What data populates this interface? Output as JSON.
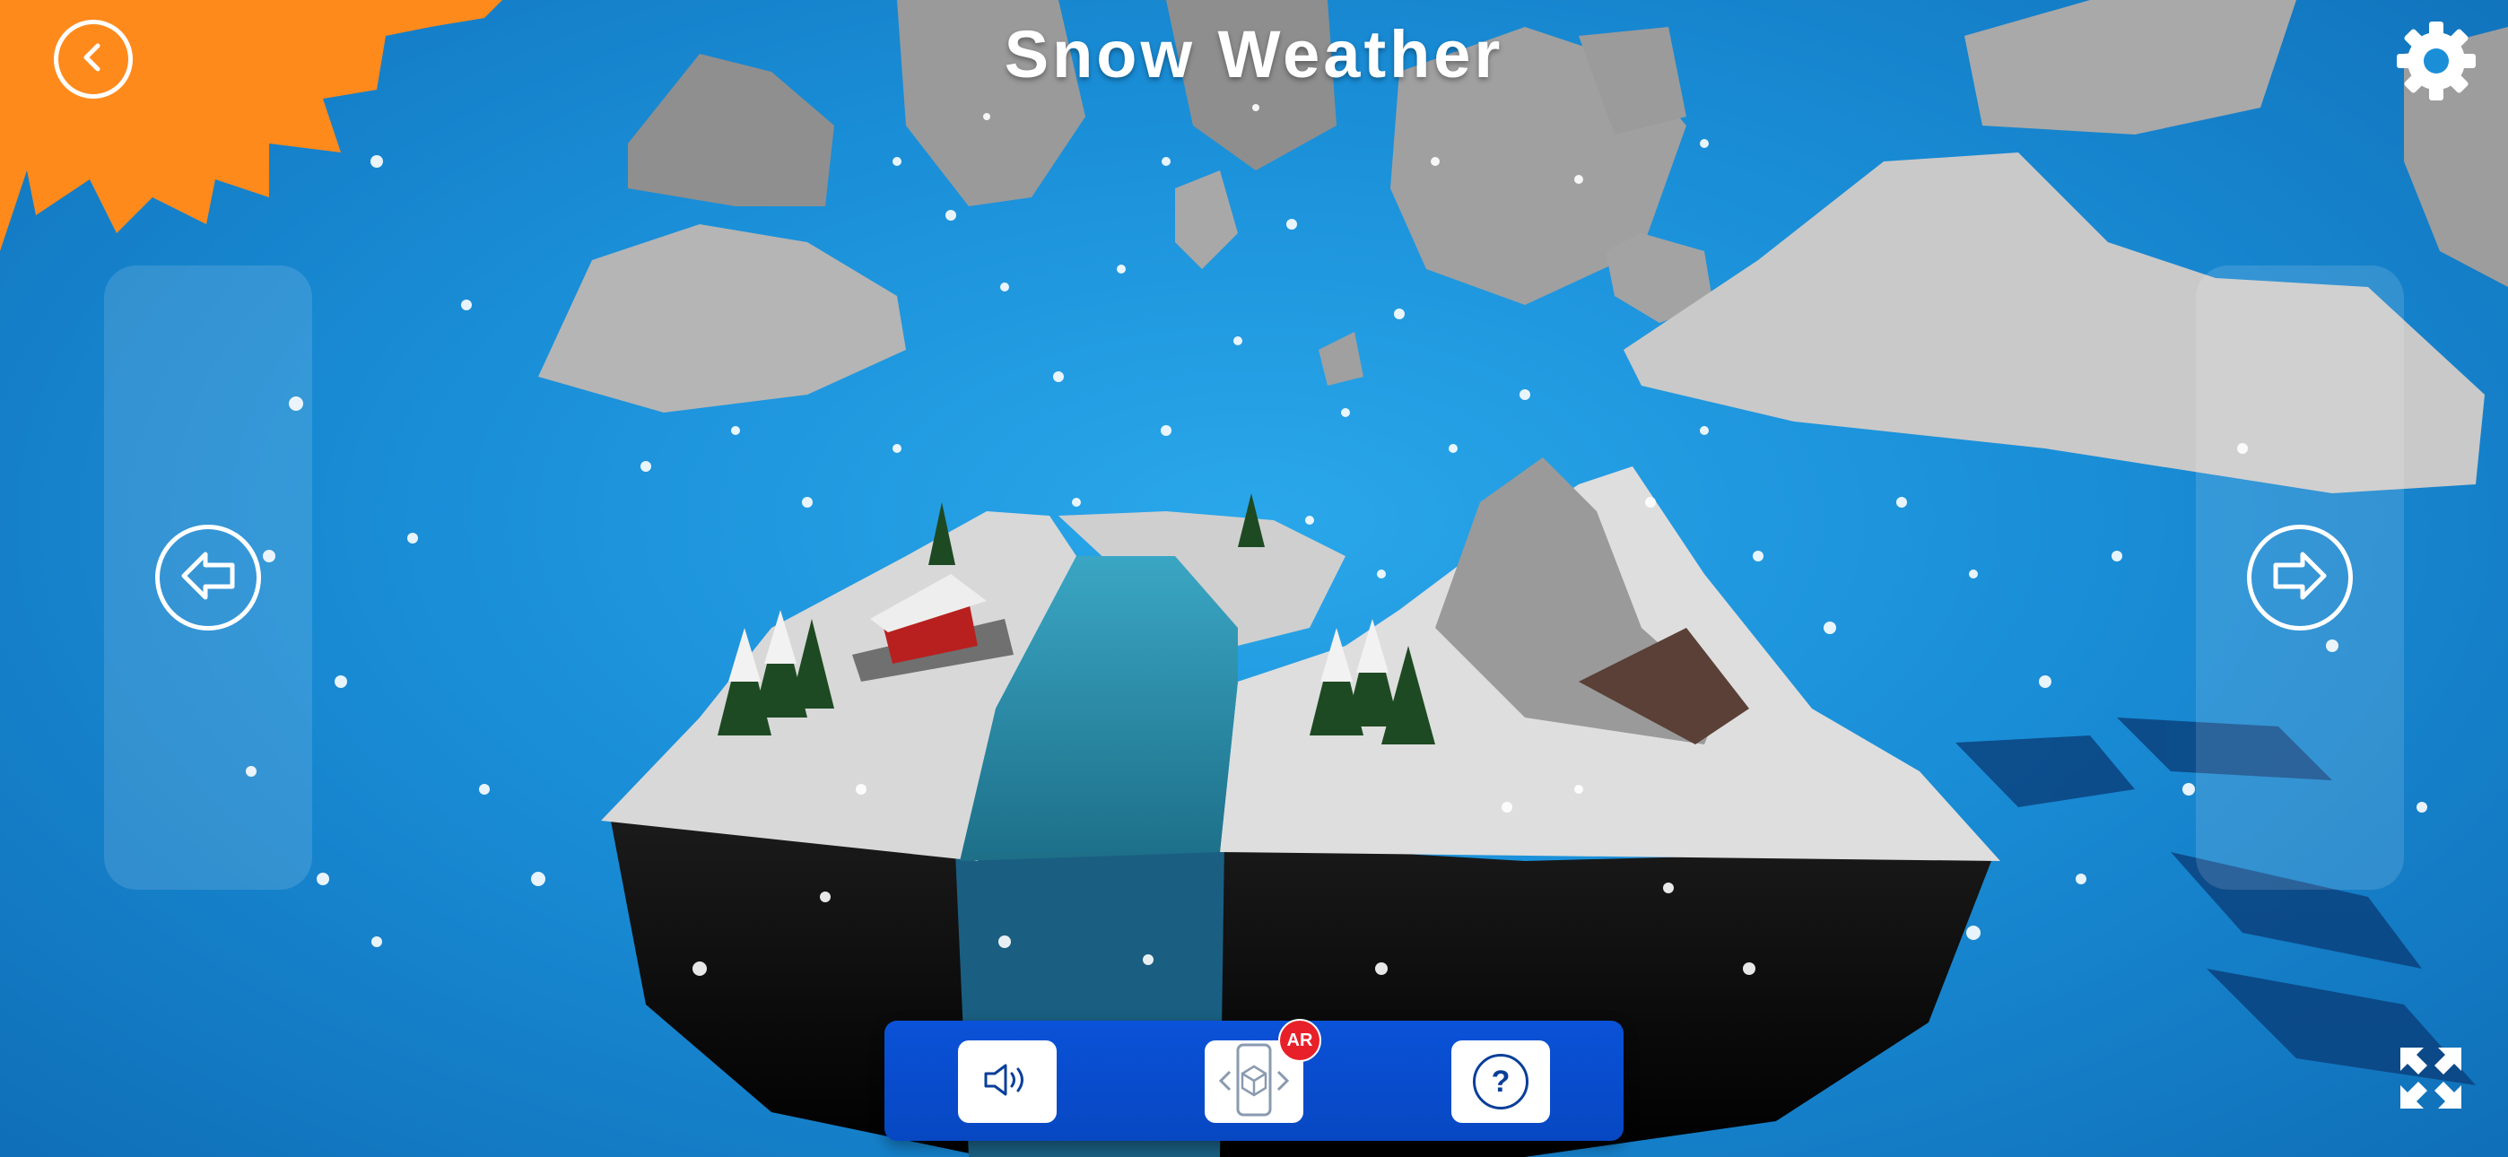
{
  "header": {
    "title": "Snow Weather"
  },
  "toolbar": {
    "ar_badge": "AR",
    "help_glyph": "?"
  },
  "colors": {
    "sky": "#1a8fd8",
    "sun": "#ff8a1c",
    "toolbar": "#0a52d8",
    "ar_badge": "#e8202a"
  },
  "icons": {
    "back": "chevron-left-icon",
    "settings": "gear-icon",
    "prev": "arrow-left-icon",
    "next": "arrow-right-icon",
    "sound": "speaker-icon",
    "ar": "ar-phone-icon",
    "help": "question-icon",
    "fullscreen": "fullscreen-icon"
  }
}
